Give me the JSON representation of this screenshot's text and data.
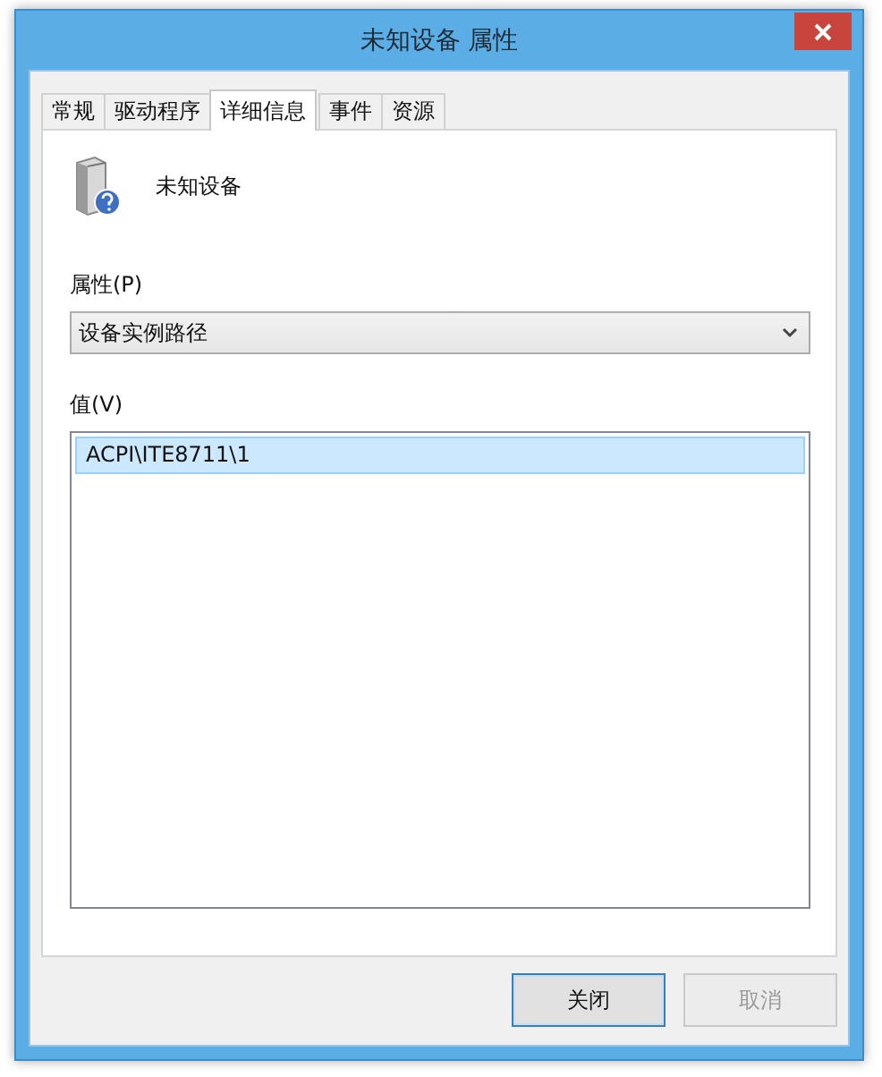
{
  "window": {
    "title": "未知设备 属性"
  },
  "tabs": [
    {
      "label": "常规",
      "selected": false
    },
    {
      "label": "驱动程序",
      "selected": false
    },
    {
      "label": "详细信息",
      "selected": true
    },
    {
      "label": "事件",
      "selected": false
    },
    {
      "label": "资源",
      "selected": false
    }
  ],
  "device": {
    "name": "未知设备"
  },
  "property": {
    "label": "属性(P)",
    "value": "设备实例路径"
  },
  "values": {
    "label": "值(V)",
    "items": [
      {
        "text": "ACPI\\ITE8711\\1",
        "selected": true
      }
    ]
  },
  "buttons": [
    {
      "label": "关闭",
      "default": true,
      "disabled": false
    },
    {
      "label": "取消",
      "default": false,
      "disabled": true
    }
  ]
}
